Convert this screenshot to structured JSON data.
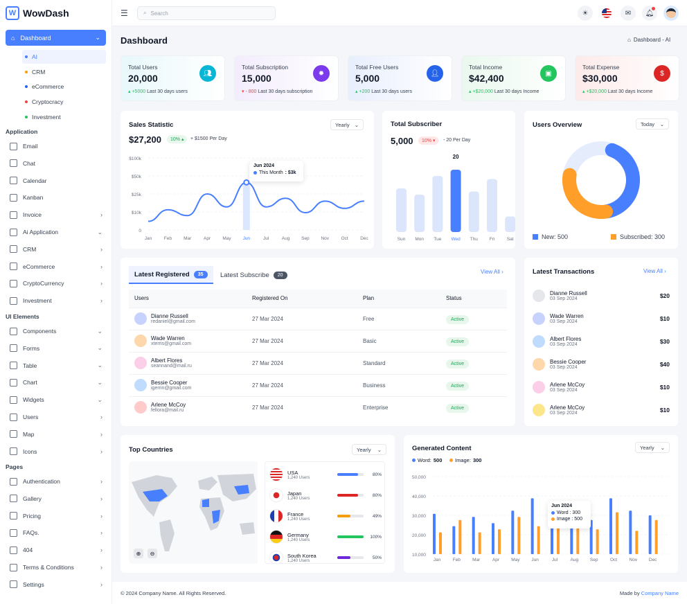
{
  "brand": {
    "name": "WowDash"
  },
  "sidebar": {
    "dashboard": "Dashboard",
    "subitems": [
      {
        "label": "AI",
        "color": "#487fff"
      },
      {
        "label": "CRM",
        "color": "#f59e0b"
      },
      {
        "label": "eCommerce",
        "color": "#2563eb"
      },
      {
        "label": "Cryptocracy",
        "color": "#ef4444"
      },
      {
        "label": "Investment",
        "color": "#22c55e"
      }
    ],
    "sections": [
      "Application",
      "UI Elements",
      "Pages"
    ],
    "application": [
      "Email",
      "Chat",
      "Calendar",
      "Kanban",
      "Invoice",
      "Ai Application",
      "CRM",
      "eCommerce",
      "CryptoCurrency",
      "Investment"
    ],
    "ui": [
      "Components",
      "Forms",
      "Table",
      "Chart",
      "Widgets",
      "Users",
      "Map",
      "Icons"
    ],
    "pages": [
      "Authentication",
      "Gallery",
      "Pricing",
      "FAQs.",
      "404",
      "Terms & Conditions",
      "Settings"
    ]
  },
  "topbar": {
    "search_placeholder": "Search"
  },
  "page": {
    "title": "Dashboard",
    "breadcrumb": "Dashboard - AI"
  },
  "stats": [
    {
      "title": "Total Users",
      "value": "20,000",
      "delta": "+5000",
      "foot": "Last 30 days users",
      "dir": "up",
      "color": "#06b6d4"
    },
    {
      "title": "Total Subscription",
      "value": "15,000",
      "delta": "- 800",
      "foot": "Last 30 days subscription",
      "dir": "down",
      "color": "#7c3aed"
    },
    {
      "title": "Total Free Users",
      "value": "5,000",
      "delta": "+200",
      "foot": "Last 30 days users",
      "dir": "up",
      "color": "#2563eb"
    },
    {
      "title": "Total Income",
      "value": "$42,400",
      "delta": "+$20,000",
      "foot": "Last 30 days Income",
      "dir": "up",
      "color": "#22c55e"
    },
    {
      "title": "Total Expense",
      "value": "$30,000",
      "delta": "+$20,000",
      "foot": "Last 30 days Income",
      "dir": "up",
      "color": "#dc2626"
    }
  ],
  "sales": {
    "title": "Sales Statistic",
    "filter": "Yearly",
    "value": "$27,200",
    "badge": "10%",
    "per_day": "+ $1500 Per Day",
    "tooltip_title": "Jun 2024",
    "tooltip_label": "This Month",
    "tooltip_value": ": $3k"
  },
  "subscriber": {
    "title": "Total Subscriber",
    "value": "5,000",
    "badge": "10%",
    "per_day": "- 20 Per Day",
    "peak": "20"
  },
  "overview": {
    "title": "Users Overview",
    "filter": "Today",
    "new_label": "New: 500",
    "sub_label": "Subscribed: 300"
  },
  "latest": {
    "tab1": "Latest Registered",
    "tab1_count": "35",
    "tab2": "Latest Subscribe",
    "tab2_count": "20",
    "view_all": "View All",
    "headers": [
      "Users",
      "Registered On",
      "Plan",
      "Status"
    ],
    "rows": [
      {
        "name": "Dianne Russell",
        "email": "redaniel@gmail.com",
        "date": "27 Mar 2024",
        "plan": "Free",
        "status": "Active"
      },
      {
        "name": "Wade Warren",
        "email": "xterris@gmail.com",
        "date": "27 Mar 2024",
        "plan": "Basic",
        "status": "Active"
      },
      {
        "name": "Albert Flores",
        "email": "seannand@mail.ru",
        "date": "27 Mar 2024",
        "plan": "Standard",
        "status": "Active"
      },
      {
        "name": "Bessie Cooper",
        "email": "igerrin@gmail.com",
        "date": "27 Mar 2024",
        "plan": "Business",
        "status": "Active"
      },
      {
        "name": "Arlene McCoy",
        "email": "fellora@mail.ru",
        "date": "27 Mar 2024",
        "plan": "Enterprise",
        "status": "Active"
      }
    ]
  },
  "transactions": {
    "title": "Latest Transactions",
    "view_all": "View All",
    "rows": [
      {
        "name": "Dianne Russell",
        "date": "03 Sep 2024",
        "amount": "$20"
      },
      {
        "name": "Wade Warren",
        "date": "03 Sep 2024",
        "amount": "$10"
      },
      {
        "name": "Albert Flores",
        "date": "03 Sep 2024",
        "amount": "$30"
      },
      {
        "name": "Bessie Cooper",
        "date": "03 Sep 2024",
        "amount": "$40"
      },
      {
        "name": "Arlene McCoy",
        "date": "03 Sep 2024",
        "amount": "$10"
      },
      {
        "name": "Arlene McCoy",
        "date": "03 Sep 2024",
        "amount": "$10"
      }
    ]
  },
  "countries": {
    "title": "Top Countries",
    "filter": "Yearly",
    "rows": [
      {
        "name": "USA",
        "users": "1,240 Users",
        "pct": "80%",
        "fill": 0.8,
        "color": "#487fff"
      },
      {
        "name": "Japan",
        "users": "1,240 Users",
        "pct": "80%",
        "fill": 0.8,
        "color": "#dc2626"
      },
      {
        "name": "France",
        "users": "1,240 Users",
        "pct": "49%",
        "fill": 0.49,
        "color": "#f59e0b"
      },
      {
        "name": "Germany",
        "users": "1,240 Users",
        "pct": "100%",
        "fill": 1.0,
        "color": "#22c55e"
      },
      {
        "name": "South Korea",
        "users": "1,240 Users",
        "pct": "50%",
        "fill": 0.5,
        "color": "#6d28d9"
      }
    ]
  },
  "generated": {
    "title": "Generated Content",
    "filter": "Yearly",
    "word_label": "Word: ",
    "word_val": "500",
    "image_label": "Image: ",
    "image_val": "300",
    "tooltip_title": "Jun 2024",
    "tt_word": "Word : 300",
    "tt_image": "Image : 500"
  },
  "footer": {
    "copy": "© 2024 Company Name. All Rights Reserved.",
    "made_by": "Made by",
    "company": "Company Name"
  },
  "chart_data": [
    {
      "type": "line",
      "title": "Sales Statistic",
      "categories": [
        "Jan",
        "Feb",
        "Mar",
        "Apr",
        "May",
        "Jun",
        "Jul",
        "Aug",
        "Sep",
        "Nov",
        "Oct",
        "Dec"
      ],
      "yticks": [
        "$100k",
        "$50k",
        "$25k",
        "$10k",
        "0"
      ],
      "values": [
        6,
        14,
        10,
        25,
        16,
        33,
        16,
        22,
        12,
        20,
        15,
        20
      ]
    },
    {
      "type": "bar",
      "title": "Total Subscriber",
      "categories": [
        "Sun",
        "Mon",
        "Tue",
        "Wed",
        "Thu",
        "Fri",
        "Sat"
      ],
      "values": [
        14,
        12,
        18,
        20,
        13,
        17,
        5
      ],
      "ylim": [
        0,
        20
      ]
    },
    {
      "type": "pie",
      "title": "Users Overview",
      "series": [
        {
          "name": "New",
          "value": 500,
          "color": "#487fff"
        },
        {
          "name": "Subscribed",
          "value": 300,
          "color": "#ff9f29"
        }
      ]
    },
    {
      "type": "bar",
      "title": "Generated Content",
      "yticks": [
        "50,000",
        "40,000",
        "30,000",
        "20,000",
        "10,000"
      ],
      "ylim": [
        0,
        50000
      ],
      "categories": [
        "Jan",
        "Feb",
        "Mar",
        "Apr",
        "May",
        "Jun",
        "Jul",
        "Aug",
        "Sep",
        "Oct",
        "Nov",
        "Dec"
      ],
      "series": [
        {
          "name": "Word",
          "color": "#487fff",
          "values": [
            26000,
            18000,
            24000,
            20000,
            28000,
            36000,
            30000,
            18000,
            22000,
            36000,
            28000,
            25000
          ]
        },
        {
          "name": "Image",
          "color": "#ff9f29",
          "values": [
            14000,
            22000,
            14000,
            16000,
            24000,
            18000,
            26000,
            21000,
            16000,
            27000,
            15000,
            22000
          ]
        }
      ]
    }
  ]
}
